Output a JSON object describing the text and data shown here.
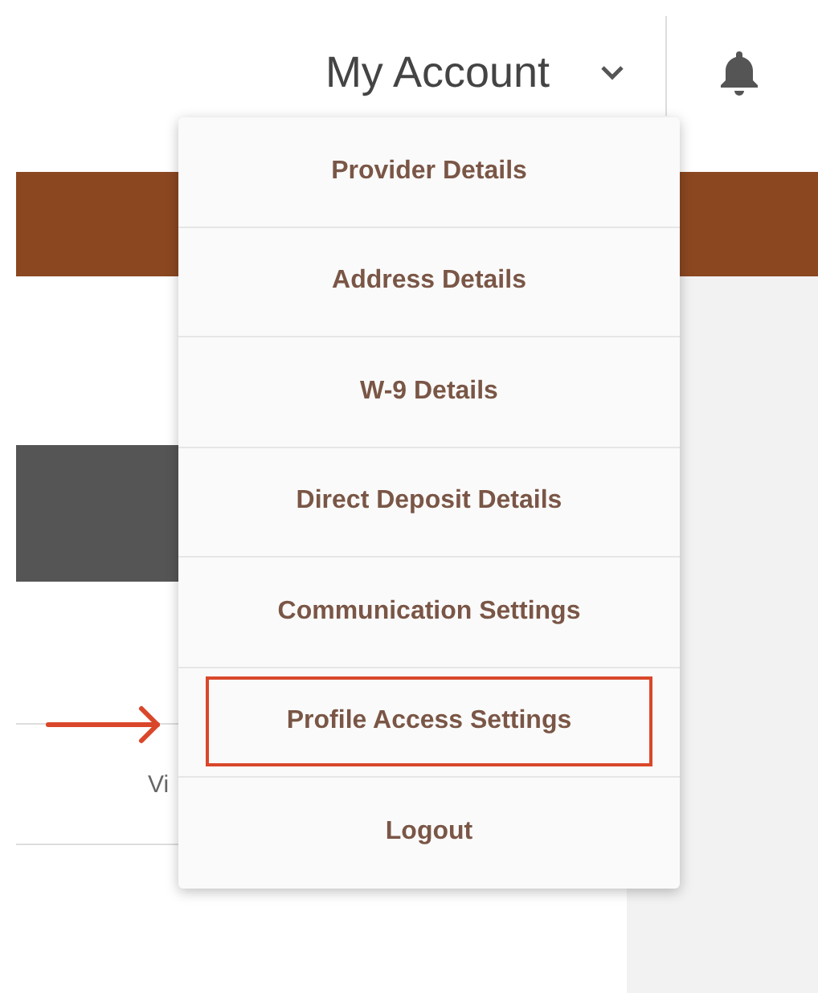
{
  "header": {
    "account_label": "My Account"
  },
  "background": {
    "cell_text": "Vi"
  },
  "account_menu": {
    "items": [
      {
        "label": "Provider Details",
        "highlighted": false
      },
      {
        "label": "Address Details",
        "highlighted": false
      },
      {
        "label": "W-9 Details",
        "highlighted": false
      },
      {
        "label": "Direct Deposit Details",
        "highlighted": false
      },
      {
        "label": "Communication Settings",
        "highlighted": false
      },
      {
        "label": "Profile Access Settings",
        "highlighted": true
      },
      {
        "label": "Logout",
        "highlighted": false
      }
    ]
  }
}
